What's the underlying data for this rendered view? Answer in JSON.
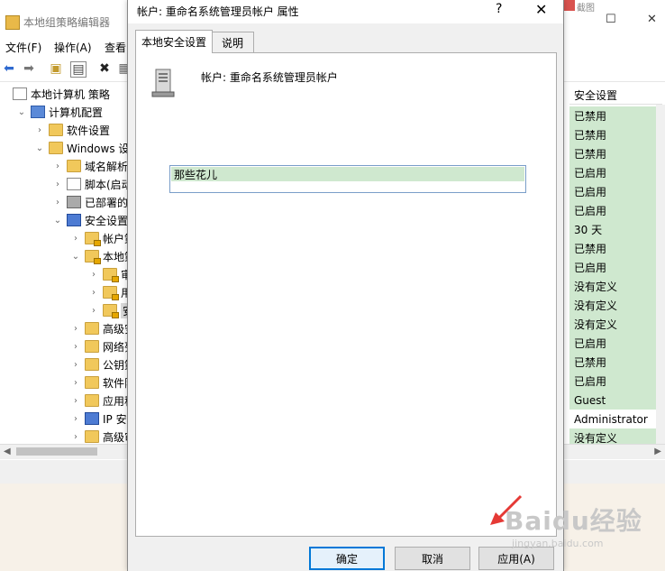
{
  "background_window": {
    "title": "本地组策略编辑器",
    "peek_tab": "截图",
    "menu": [
      "文件(F)",
      "操作(A)",
      "查看"
    ],
    "tree": [
      {
        "label": "本地计算机 策略",
        "level": 0,
        "icon": "doc"
      },
      {
        "label": "计算机配置",
        "level": 1,
        "icon": "computer",
        "expanded": true
      },
      {
        "label": "软件设置",
        "level": 2,
        "icon": "folder"
      },
      {
        "label": "Windows 设置",
        "level": 2,
        "icon": "folder",
        "expanded": true
      },
      {
        "label": "域名解析策",
        "level": 3,
        "icon": "folder"
      },
      {
        "label": "脚本(启动/关",
        "level": 3,
        "icon": "doc"
      },
      {
        "label": "已部署的打",
        "level": 3,
        "icon": "printer"
      },
      {
        "label": "安全设置",
        "level": 3,
        "icon": "shield",
        "expanded": true
      },
      {
        "label": "帐户策略",
        "level": 4,
        "icon": "folder-lock"
      },
      {
        "label": "本地策略",
        "level": 4,
        "icon": "folder-lock",
        "expanded": true
      },
      {
        "label": "审核",
        "level": 5,
        "icon": "folder-lock"
      },
      {
        "label": "用户",
        "level": 5,
        "icon": "folder-lock"
      },
      {
        "label": "安全",
        "level": 5,
        "icon": "folder-lock",
        "selected": true
      },
      {
        "label": "高级安全",
        "level": 4,
        "icon": "folder"
      },
      {
        "label": "网络列表",
        "level": 4,
        "icon": "folder"
      },
      {
        "label": "公钥策略",
        "level": 4,
        "icon": "folder"
      },
      {
        "label": "软件限制",
        "level": 4,
        "icon": "folder"
      },
      {
        "label": "应用程序",
        "level": 4,
        "icon": "folder"
      },
      {
        "label": "IP 安全策",
        "level": 4,
        "icon": "shield"
      },
      {
        "label": "高级审核",
        "level": 4,
        "icon": "folder"
      }
    ],
    "column_header": "安全设置",
    "values": [
      "已禁用",
      "已禁用",
      "已禁用",
      "已启用",
      "已启用",
      "已启用",
      "30 天",
      "已禁用",
      "已启用",
      "没有定义",
      "没有定义",
      "没有定义",
      "已启用",
      "已禁用",
      "已启用",
      "Guest",
      "Administrator",
      "没有定义"
    ],
    "white_rows": [
      16
    ]
  },
  "dialog": {
    "title": "帐户: 重命名系统管理员帐户 属性",
    "help_glyph": "?",
    "close_glyph": "✕",
    "tabs": [
      {
        "label": "本地安全设置",
        "active": true
      },
      {
        "label": "说明",
        "active": false
      }
    ],
    "account_label": "帐户: 重命名系统管理员帐户",
    "input_value": "那些花儿",
    "buttons": {
      "ok": "确定",
      "cancel": "取消",
      "apply": "应用(A)"
    }
  },
  "watermark": {
    "brand": "Baidu经验",
    "url": "jingyan.baidu.com"
  },
  "colors": {
    "highlight_green": "#cfe8cf",
    "accent_blue": "#0078d7",
    "annotation_red": "#e53935"
  }
}
